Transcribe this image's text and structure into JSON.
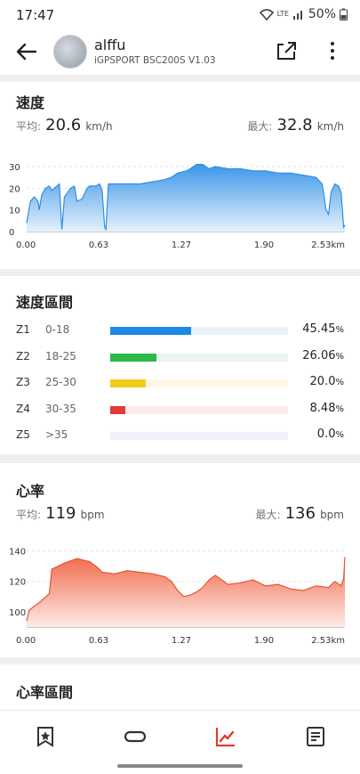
{
  "status": {
    "time": "17:47",
    "network": "LTE",
    "battery": "50%"
  },
  "header": {
    "username": "alffu",
    "device": "iGPSPORT BSC200S  V1.03"
  },
  "speed": {
    "title": "速度",
    "avg_label": "平均:",
    "avg_value": "20.6",
    "avg_unit": "km/h",
    "max_label": "最大:",
    "max_value": "32.8",
    "max_unit": "km/h",
    "chart_data": {
      "type": "area",
      "ylim": [
        0,
        30
      ],
      "yticks": [
        "0",
        "10",
        "20",
        "30"
      ],
      "xticks": [
        "0.00",
        "0.63",
        "1.27",
        "1.90",
        "2.53km"
      ],
      "x": [
        0,
        0.03,
        0.06,
        0.09,
        0.1,
        0.12,
        0.15,
        0.18,
        0.2,
        0.22,
        0.26,
        0.28,
        0.3,
        0.35,
        0.38,
        0.4,
        0.44,
        0.48,
        0.5,
        0.55,
        0.58,
        0.6,
        0.62,
        0.63,
        0.65,
        0.7,
        0.8,
        0.9,
        1.0,
        1.1,
        1.15,
        1.2,
        1.27,
        1.3,
        1.35,
        1.4,
        1.45,
        1.5,
        1.6,
        1.7,
        1.8,
        1.9,
        2.0,
        2.1,
        2.2,
        2.3,
        2.35,
        2.38,
        2.4,
        2.42,
        2.45,
        2.48,
        2.5,
        2.52,
        2.53
      ],
      "y": [
        4,
        14,
        16,
        14,
        10,
        17,
        20,
        21,
        19,
        20,
        22,
        1,
        16,
        20,
        21,
        14,
        15,
        20,
        21,
        21,
        22,
        19,
        2,
        1,
        22,
        22,
        22,
        22,
        23,
        24,
        25,
        27,
        28,
        29,
        31,
        31,
        29,
        30,
        29,
        29,
        28,
        28,
        27,
        27,
        26,
        25,
        22,
        10,
        8,
        18,
        22,
        21,
        18,
        2,
        3
      ]
    }
  },
  "speed_zones": {
    "title": "速度區間",
    "zones": [
      {
        "id": "Z1",
        "range": "0-18",
        "pct": "45.45",
        "fraction": 0.4545,
        "color": "#1e88e5",
        "track": "#e8f2fb"
      },
      {
        "id": "Z2",
        "range": "18-25",
        "pct": "26.06",
        "fraction": 0.2606,
        "color": "#2db84a",
        "track": "#eaf6ee"
      },
      {
        "id": "Z3",
        "range": "25-30",
        "pct": "20.0",
        "fraction": 0.2,
        "color": "#f2cc18",
        "track": "#fdf8e6"
      },
      {
        "id": "Z4",
        "range": "30-35",
        "pct": "8.48",
        "fraction": 0.0848,
        "color": "#e53935",
        "track": "#fbeceb"
      },
      {
        "id": "Z5",
        "range": ">35",
        "pct": "0.0",
        "fraction": 0.0,
        "color": "#b48bd6",
        "track": "#f4eefa"
      }
    ],
    "percent_sign": "%"
  },
  "heart_rate": {
    "title": "心率",
    "avg_label": "平均:",
    "avg_value": "119",
    "avg_unit": "bpm",
    "max_label": "最大:",
    "max_value": "136",
    "max_unit": "bpm",
    "chart_data": {
      "type": "area",
      "ylim": [
        90,
        145
      ],
      "yticks": [
        "100",
        "120",
        "140"
      ],
      "xticks": [
        "0.00",
        "0.63",
        "1.27",
        "1.90",
        "2.53km"
      ],
      "x": [
        0,
        0.02,
        0.05,
        0.1,
        0.18,
        0.2,
        0.3,
        0.4,
        0.5,
        0.55,
        0.6,
        0.7,
        0.8,
        0.9,
        1.0,
        1.1,
        1.15,
        1.2,
        1.25,
        1.3,
        1.35,
        1.4,
        1.45,
        1.5,
        1.6,
        1.7,
        1.8,
        1.9,
        2.0,
        2.1,
        2.2,
        2.3,
        2.4,
        2.45,
        2.5,
        2.52,
        2.53
      ],
      "y": [
        94,
        101,
        103,
        106,
        112,
        128,
        132,
        135,
        133,
        130,
        126,
        125,
        127,
        126,
        125,
        123,
        120,
        114,
        110,
        111,
        113,
        116,
        121,
        124,
        118,
        119,
        121,
        117,
        118,
        115,
        114,
        117,
        116,
        120,
        117,
        122,
        136
      ]
    }
  },
  "hr_zones": {
    "title": "心率區間"
  },
  "nav": {
    "items": [
      {
        "name": "bookmark"
      },
      {
        "name": "route"
      },
      {
        "name": "chart",
        "active": true
      },
      {
        "name": "document"
      }
    ],
    "active_color": "#e5392b",
    "inactive_color": "#333333"
  }
}
